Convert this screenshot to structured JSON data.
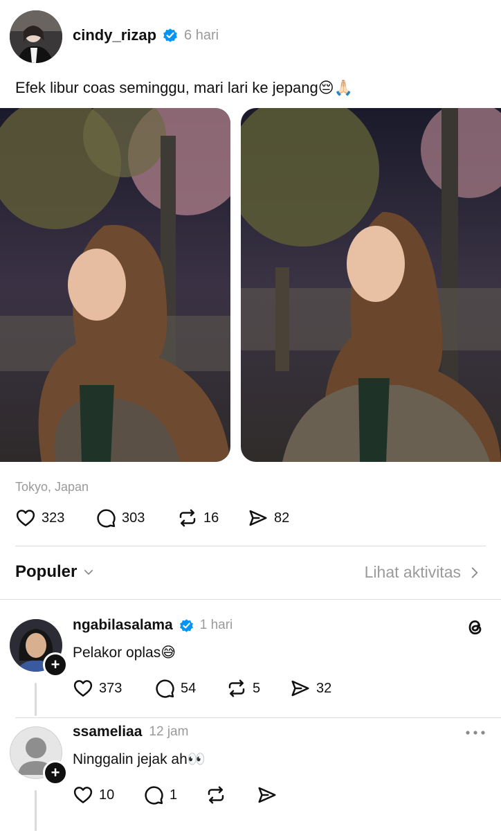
{
  "post": {
    "username": "cindy_rizap",
    "time": "6 hari",
    "text": "Efek libur coas seminggu, mari lari ke jepang😔🙏🏻",
    "location": "Tokyo, Japan",
    "likes": "323",
    "comments": "303",
    "reposts": "16",
    "shares": "82"
  },
  "sort_bar": {
    "label": "Populer",
    "activity_link": "Lihat aktivitas"
  },
  "replies": [
    {
      "username": "ngabilasalama",
      "time": "1 hari",
      "text": "Pelakor oplas😅",
      "likes": "373",
      "comments": "54",
      "reposts": "5",
      "shares": "32"
    },
    {
      "username": "ssameliaa",
      "time": "12 jam",
      "text": "Ninggalin jejak ah👀",
      "likes": "10",
      "comments": "1",
      "reposts": "",
      "shares": ""
    }
  ],
  "icons": {
    "verified": "verified-badge-icon",
    "like": "heart-icon",
    "comment": "comment-bubble-icon",
    "repost": "repost-icon",
    "share": "send-icon",
    "threads": "threads-logo-icon",
    "more": "more-dots-icon",
    "chevron_down": "chevron-down-icon",
    "chevron_right": "chevron-right-icon"
  },
  "colors": {
    "verified_blue": "#0095f6",
    "muted_text": "#9a9a9a"
  }
}
